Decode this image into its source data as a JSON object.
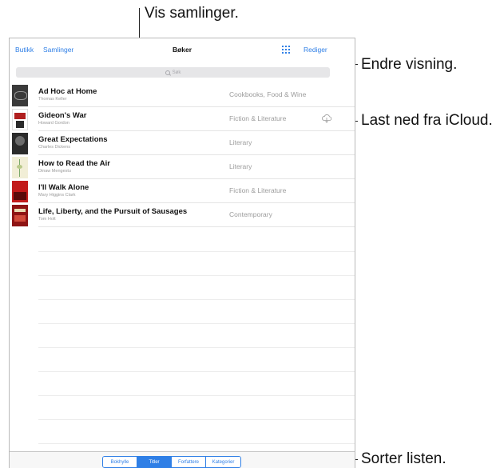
{
  "callouts": {
    "show_collections": "Vis samlinger.",
    "change_view": "Endre visning.",
    "download_icloud": "Last ned fra iCloud.",
    "sort_list": "Sorter listen."
  },
  "navbar": {
    "store": "Butikk",
    "collections": "Samlinger",
    "title": "Bøker",
    "edit": "Rediger",
    "grid_icon": "grid-view-icon"
  },
  "search": {
    "placeholder": "Søk",
    "icon": "search-icon"
  },
  "books": [
    {
      "title": "Ad Hoc at Home",
      "author": "Thomas Keller",
      "category": "Cookbooks, Food & Wine",
      "cover_color": "#3a3a3a"
    },
    {
      "title": "Gideon's War",
      "author": "Howard Gordon",
      "category": "Fiction & Literature",
      "cover_color": "#b01e1e",
      "cloud": true
    },
    {
      "title": "Great Expectations",
      "author": "Charles Dickens",
      "category": "Literary",
      "cover_color": "#2b2b2b"
    },
    {
      "title": "How to Read the Air",
      "author": "Dinaw Mengestu",
      "category": "Literary",
      "cover_color": "#eee8c8"
    },
    {
      "title": "I'll Walk Alone",
      "author": "Mary Higgins Clark",
      "category": "Fiction & Literature",
      "cover_color": "#c21b1b"
    },
    {
      "title": "Life, Liberty, and the Pursuit of Sausages",
      "author": "Tom Holt",
      "category": "Contemporary",
      "cover_color": "#8e1414"
    }
  ],
  "sort_tabs": [
    {
      "label": "Bokhylle",
      "active": false
    },
    {
      "label": "Titler",
      "active": true
    },
    {
      "label": "Forfattere",
      "active": false
    },
    {
      "label": "Kategorier",
      "active": false
    }
  ],
  "colors": {
    "accent": "#2f7fe6"
  }
}
